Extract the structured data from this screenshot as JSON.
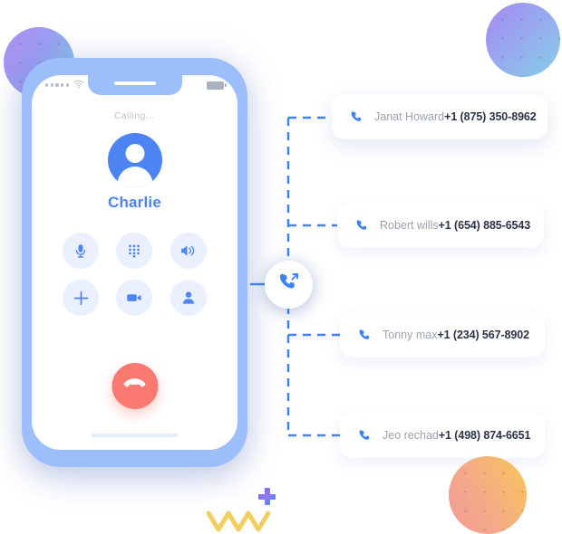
{
  "phone": {
    "status_bar": {
      "signal_icon": "signal-dots-icon",
      "wifi_icon": "wifi-icon",
      "battery_icon": "battery-icon"
    },
    "calling_label": "Calling...",
    "caller_name": "Charlie",
    "avatar_icon": "user-avatar-icon",
    "controls": [
      {
        "name": "mute",
        "icon": "microphone-icon"
      },
      {
        "name": "keypad",
        "icon": "dialpad-icon"
      },
      {
        "name": "speaker",
        "icon": "speaker-icon"
      },
      {
        "name": "add-call",
        "icon": "plus-icon"
      },
      {
        "name": "video",
        "icon": "video-camera-icon"
      },
      {
        "name": "contacts",
        "icon": "person-icon"
      }
    ],
    "end_call": {
      "name": "end-call",
      "icon": "hangup-icon"
    }
  },
  "hub": {
    "icon": "outgoing-call-icon"
  },
  "contacts": [
    {
      "name": "Janat Howard",
      "number": "+1 (875) 350-8962",
      "icon": "phone-icon"
    },
    {
      "name": "Robert wills",
      "number": "+1 (654) 885-6543",
      "icon": "phone-icon"
    },
    {
      "name": "Tonny max",
      "number": "+1 (234) 567-8902",
      "icon": "phone-icon"
    },
    {
      "name": "Jeo rechad",
      "number": "+1 (498) 874-6651",
      "icon": "phone-icon"
    }
  ],
  "decor": {
    "plus_mark": "plus-decoration",
    "zigzag": "zigzag-decoration",
    "blob_top_left": "gradient-circle-decoration",
    "blob_top_right": "gradient-circle-decoration",
    "blob_bottom_right": "gradient-circle-decoration"
  },
  "colors": {
    "accent_blue": "#4d84f3",
    "phone_frame": "#9cbefb",
    "end_call_red": "#fa7a72",
    "dash_blue": "#3b82f6",
    "name_gray": "#9ba2ae",
    "number_dark": "#2c3444",
    "zigzag_yellow": "#f5cd5e"
  }
}
